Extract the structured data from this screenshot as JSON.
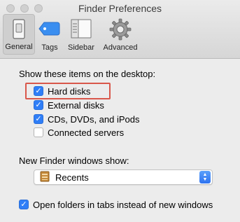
{
  "window": {
    "title": "Finder Preferences"
  },
  "toolbar": {
    "items": [
      {
        "label": "General",
        "icon": "general-icon",
        "active": true
      },
      {
        "label": "Tags",
        "icon": "tag-icon",
        "active": false
      },
      {
        "label": "Sidebar",
        "icon": "sidebar-icon",
        "active": false
      },
      {
        "label": "Advanced",
        "icon": "gear-icon",
        "active": false
      }
    ]
  },
  "desktop_items": {
    "heading": "Show these items on the desktop:",
    "options": [
      {
        "label": "Hard disks",
        "checked": true,
        "highlighted": true
      },
      {
        "label": "External disks",
        "checked": true
      },
      {
        "label": "CDs, DVDs, and iPods",
        "checked": true
      },
      {
        "label": "Connected servers",
        "checked": false
      }
    ]
  },
  "new_window": {
    "heading": "New Finder windows show:",
    "selected": "Recents",
    "icon": "folder-icon"
  },
  "tabs_option": {
    "label": "Open folders in tabs instead of new windows",
    "checked": true
  },
  "colors": {
    "accent": "#2f7ef7",
    "highlight": "#d9574b"
  }
}
